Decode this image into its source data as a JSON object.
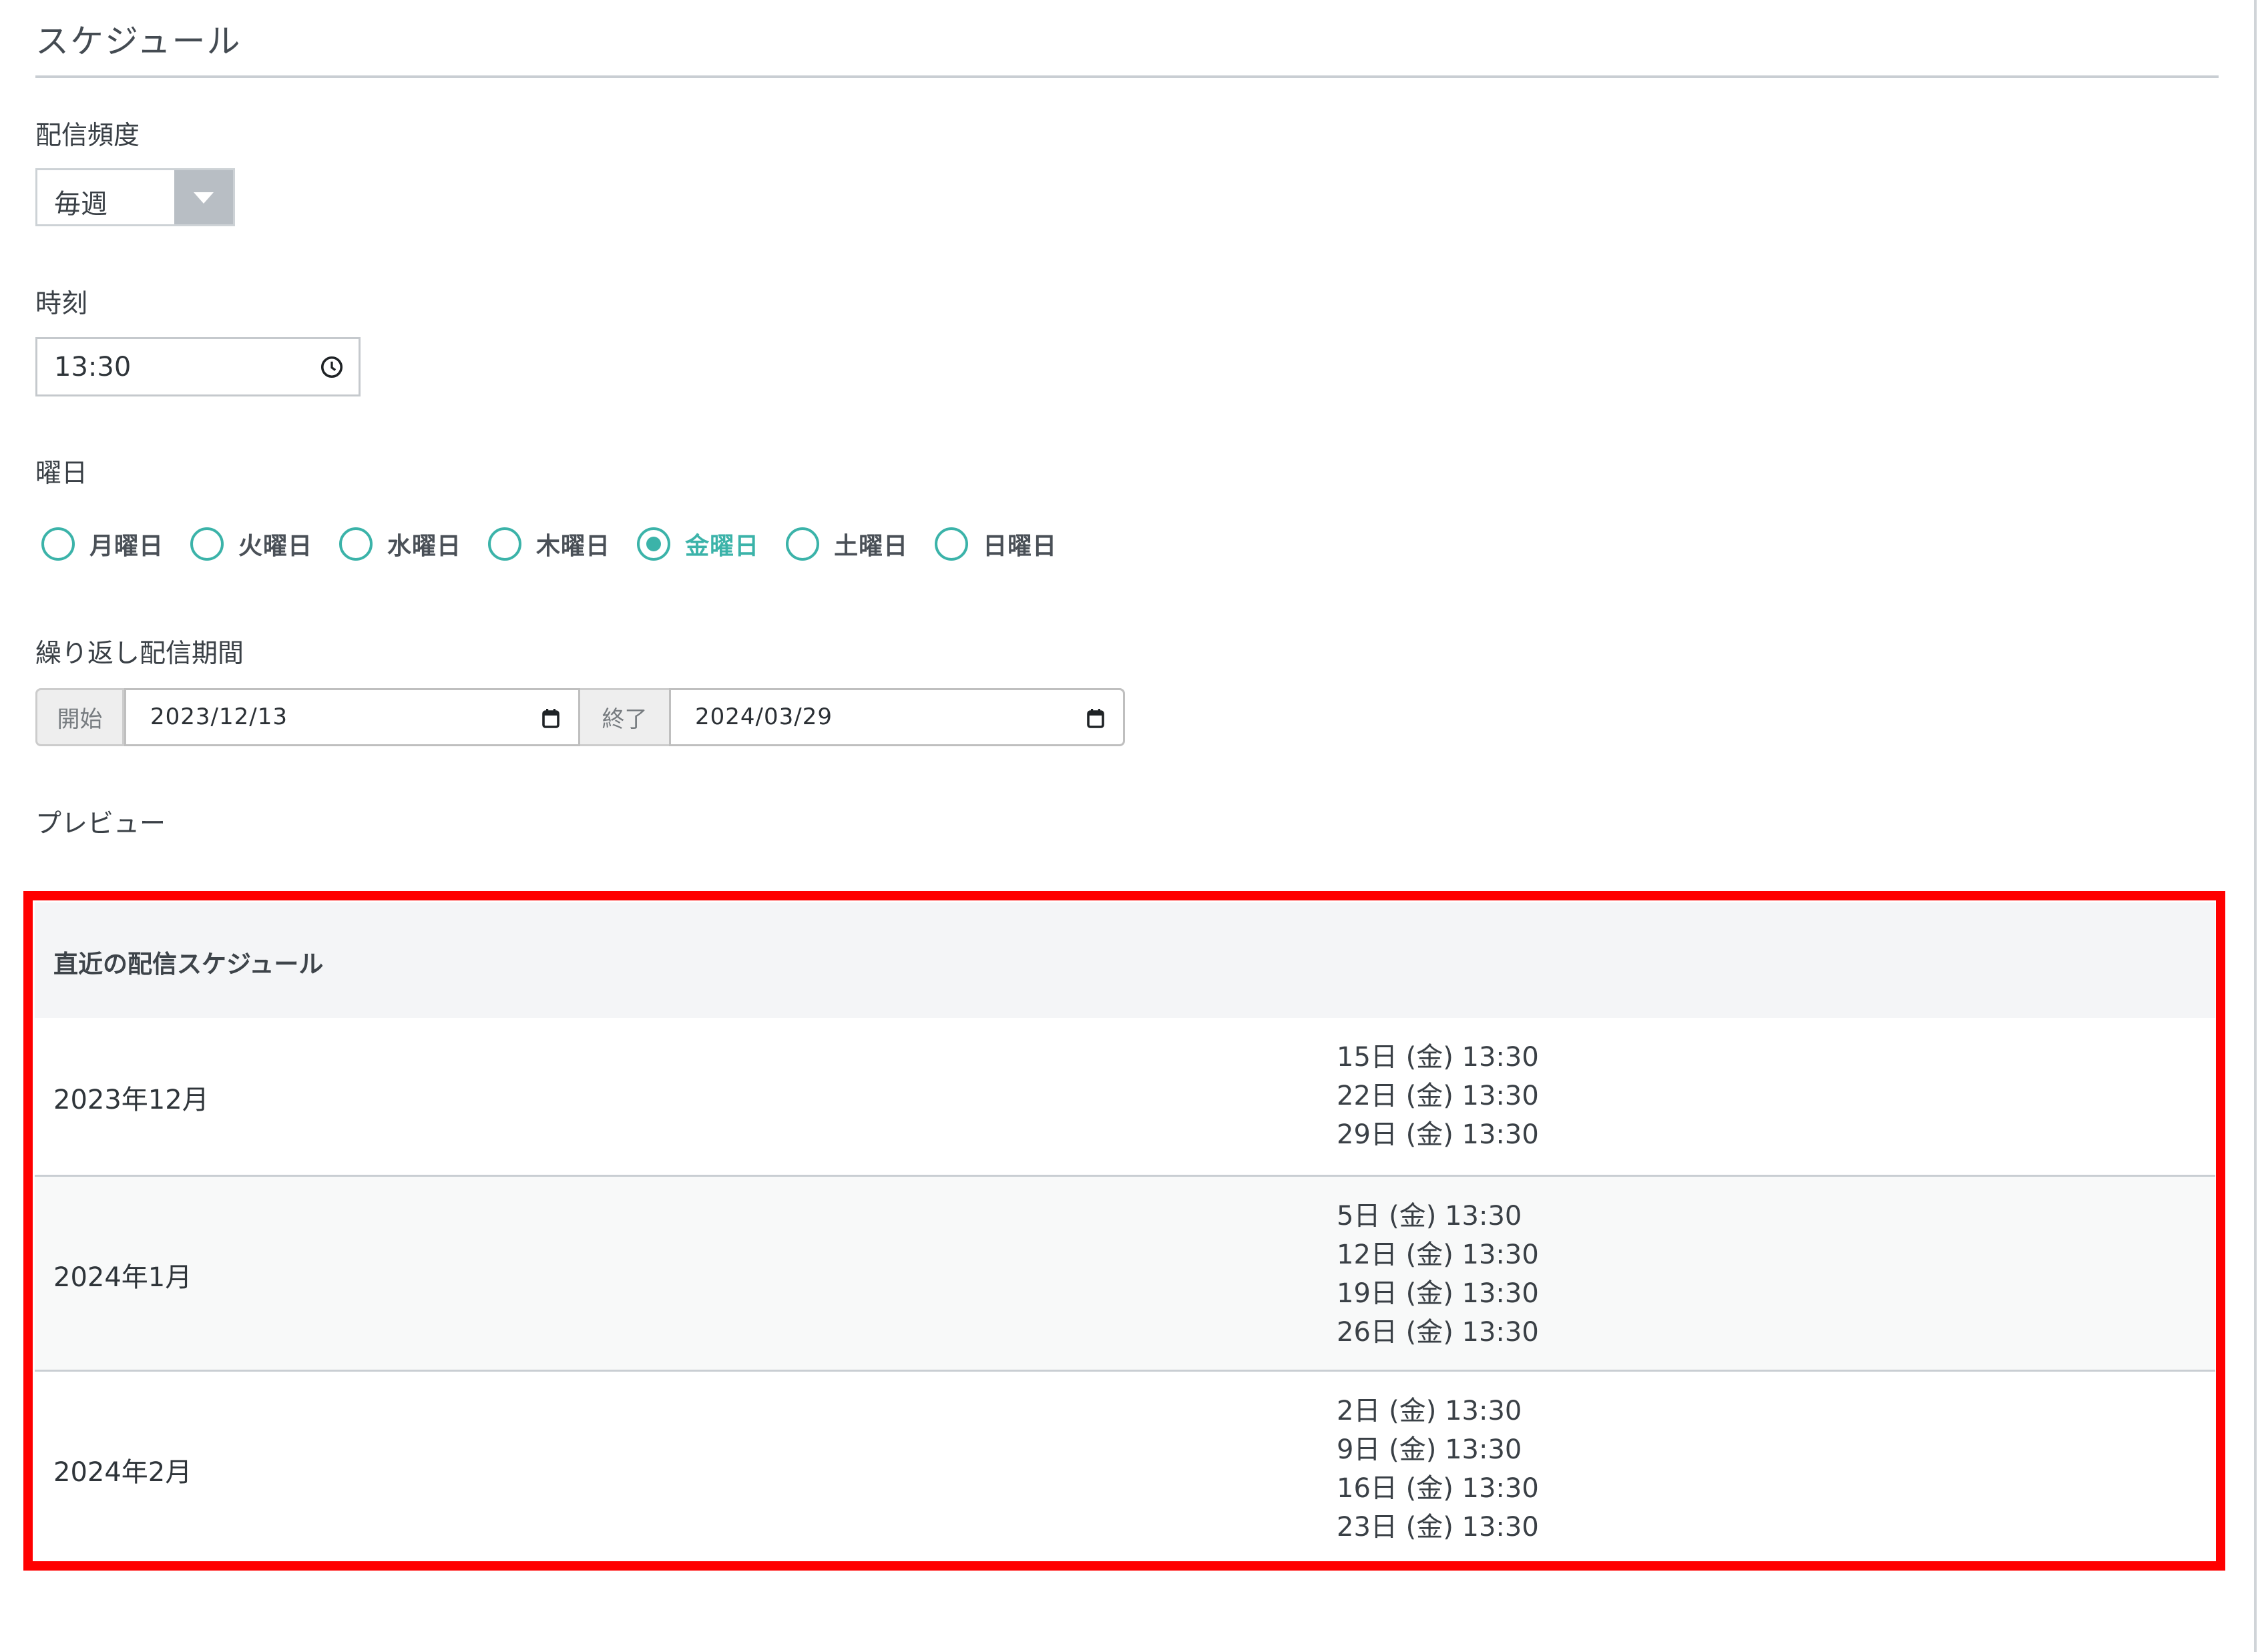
{
  "section_title": "スケジュール",
  "frequency": {
    "label": "配信頻度",
    "value": "毎週"
  },
  "time": {
    "label": "時刻",
    "value": "13:30"
  },
  "weekday": {
    "label": "曜日",
    "options": [
      {
        "label": "月曜日",
        "checked": false
      },
      {
        "label": "火曜日",
        "checked": false
      },
      {
        "label": "水曜日",
        "checked": false
      },
      {
        "label": "木曜日",
        "checked": false
      },
      {
        "label": "金曜日",
        "checked": true
      },
      {
        "label": "土曜日",
        "checked": false
      },
      {
        "label": "日曜日",
        "checked": false
      }
    ]
  },
  "period": {
    "label": "繰り返し配信期間",
    "start_label": "開始",
    "start_value": "2023/12/13",
    "end_label": "終了",
    "end_value": "2024/03/29"
  },
  "preview": {
    "label": "プレビュー",
    "table_header": "直近の配信スケジュール",
    "rows": [
      {
        "month": "2023年12月",
        "dates": [
          "15日 (金) 13:30",
          "22日 (金) 13:30",
          "29日 (金) 13:30"
        ]
      },
      {
        "month": "2024年1月",
        "dates": [
          "5日 (金) 13:30",
          "12日 (金) 13:30",
          "19日 (金) 13:30",
          "26日 (金) 13:30"
        ]
      },
      {
        "month": "2024年2月",
        "dates": [
          "2日 (金) 13:30",
          "9日 (金) 13:30",
          "16日 (金) 13:30",
          "23日 (金) 13:30"
        ]
      }
    ]
  },
  "colors": {
    "accent": "#3bb3a9",
    "highlight_border": "#ff0000"
  }
}
